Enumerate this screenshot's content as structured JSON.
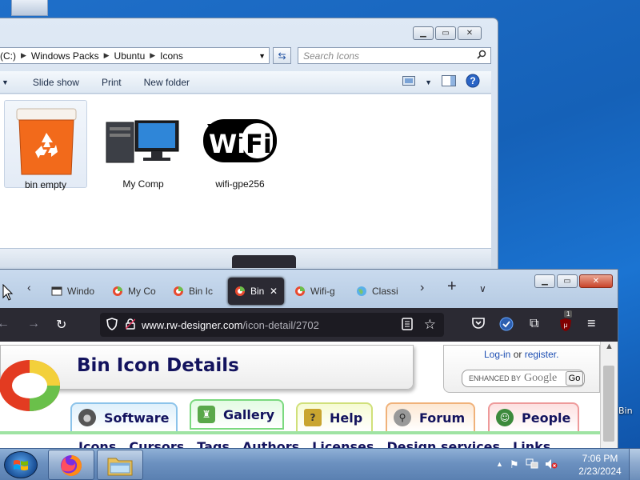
{
  "desktop": {
    "right_label": "Bin"
  },
  "explorer": {
    "breadcrumb": [
      "(C:)",
      "Windows Packs",
      "Ubuntu",
      "Icons"
    ],
    "search_placeholder": "Search Icons",
    "commands": [
      "Slide show",
      "Print",
      "New folder"
    ],
    "files": [
      {
        "label": "bin empty",
        "icon": "recycle-bin-icon",
        "selected": true
      },
      {
        "label": "My Comp",
        "icon": "computer-icon",
        "selected": false
      },
      {
        "label": "wifi-gpe256",
        "icon": "wifi-icon",
        "selected": false
      }
    ]
  },
  "firefox": {
    "tabs": [
      {
        "label": "Windo",
        "icon": "window-icon"
      },
      {
        "label": "My Co",
        "icon": "rw-logo-icon"
      },
      {
        "label": "Bin Ic",
        "icon": "rw-logo-icon"
      },
      {
        "label": "Bin",
        "icon": "rw-logo-icon",
        "active": true
      },
      {
        "label": "Wifi-g",
        "icon": "rw-logo-icon"
      },
      {
        "label": "Classi",
        "icon": "globe-icon"
      }
    ],
    "url_host": "www.rw-designer.com",
    "url_path": "/icon-detail/2702",
    "extension_badge": "1"
  },
  "page": {
    "title": "Bin Icon Details",
    "login": "Log-in",
    "or": "or",
    "register": "register.",
    "enhanced_by": "ENHANCED BY",
    "google": "Google",
    "go": "Go",
    "nav": [
      "Software",
      "Gallery",
      "Help",
      "Forum",
      "People"
    ],
    "subnav": [
      "Icons",
      "Cursors",
      "Tags",
      "Authors",
      "Licenses",
      "Design services",
      "Links"
    ]
  },
  "taskbar": {
    "time": "7:06 PM",
    "date": "2/23/2024"
  }
}
